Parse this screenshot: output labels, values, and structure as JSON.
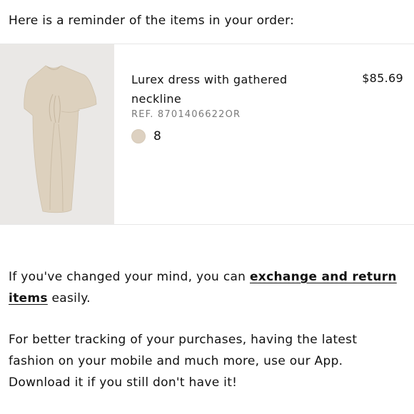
{
  "intro": "Here is a reminder of the items in your order:",
  "item": {
    "image_description": "beige dress",
    "name": "Lurex dress with gathered neckline",
    "price": "$85.69",
    "ref": "REF. 8701406622OR",
    "color_swatch": "#ddd1c1",
    "size": "8"
  },
  "message": {
    "line1_prefix": "If you've changed your mind, you can ",
    "link_text": "exchange and return items",
    "line1_suffix": " easily.",
    "line2": "For better tracking of your purchases, having the latest fashion on your mobile and much more, use our App. Download it if you still don't have it!"
  }
}
